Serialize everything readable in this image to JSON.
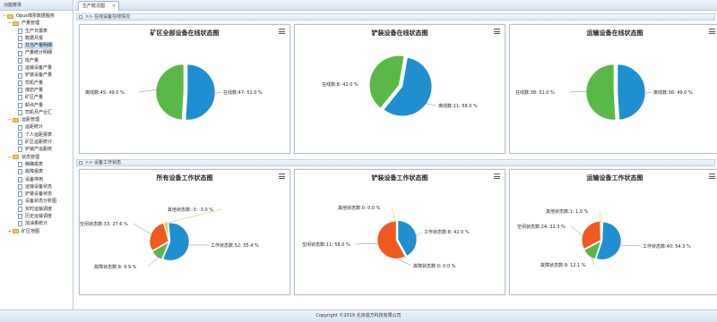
{
  "sidebar": {
    "title": "功能菜单",
    "items": [
      {
        "label": "Opus煤票数据服务",
        "level": 0,
        "type": "folder",
        "open": true
      },
      {
        "label": "产量管理",
        "level": 1,
        "type": "folder",
        "open": true
      },
      {
        "label": "生产日报表",
        "level": 2,
        "type": "doc"
      },
      {
        "label": "数据月报",
        "level": 2,
        "type": "doc"
      },
      {
        "label": "日当产量明细",
        "level": 2,
        "type": "doc",
        "selected": true
      },
      {
        "label": "产量统计明细",
        "level": 2,
        "type": "doc"
      },
      {
        "label": "班产量",
        "level": 2,
        "type": "doc"
      },
      {
        "label": "运输设备产量",
        "level": 2,
        "type": "doc"
      },
      {
        "label": "铲装设备产量",
        "level": 2,
        "type": "doc"
      },
      {
        "label": "司机产量",
        "level": 2,
        "type": "doc"
      },
      {
        "label": "煤岩产量",
        "level": 2,
        "type": "doc"
      },
      {
        "label": "矿区产量",
        "level": 2,
        "type": "doc"
      },
      {
        "label": "卸点产量",
        "level": 2,
        "type": "doc"
      },
      {
        "label": "司机月产台汇",
        "level": 2,
        "type": "doc"
      },
      {
        "label": "运距管理",
        "level": 1,
        "type": "folder",
        "open": true
      },
      {
        "label": "运距统计",
        "level": 2,
        "type": "doc"
      },
      {
        "label": "个人运距报表",
        "level": 2,
        "type": "doc"
      },
      {
        "label": "矿区运距统计",
        "level": 2,
        "type": "doc"
      },
      {
        "label": "铲装产运距统",
        "level": 2,
        "type": "doc"
      },
      {
        "label": "状态管理",
        "level": 1,
        "type": "folder",
        "open": true
      },
      {
        "label": "精确报表",
        "level": 2,
        "type": "doc"
      },
      {
        "label": "故障报表",
        "level": 2,
        "type": "doc"
      },
      {
        "label": "设备停用",
        "level": 2,
        "type": "doc"
      },
      {
        "label": "运输设备状态",
        "level": 2,
        "type": "doc"
      },
      {
        "label": "铲装设备状态",
        "level": 2,
        "type": "doc"
      },
      {
        "label": "设备状态分析图",
        "level": 2,
        "type": "doc"
      },
      {
        "label": "实时运输调度",
        "level": 2,
        "type": "doc"
      },
      {
        "label": "历史运输调度",
        "level": 2,
        "type": "doc"
      },
      {
        "label": "加油量统计",
        "level": 2,
        "type": "doc"
      },
      {
        "label": "矿区地图",
        "level": 1,
        "type": "folder",
        "open": false
      }
    ]
  },
  "tabs": [
    {
      "label": "生产概况图"
    }
  ],
  "sections": [
    {
      "title": ">> 在线设备在线情况"
    },
    {
      "title": ">> 设备工作状态"
    }
  ],
  "footer": "Copyright ©2019 北京逾方科技有限公司",
  "colors": {
    "green": "#59b947",
    "blue": "#1f8fd0",
    "orange": "#f05a1e",
    "yellow": "#f3cf3d"
  },
  "chart_data": [
    {
      "type": "pie",
      "title": "矿区全部设备在线状态图",
      "slices": [
        {
          "label": "在线数:47: 51.0 %",
          "value": 51.0,
          "color": "#1f8fd0"
        },
        {
          "label": "离线数:45: 49.0 %",
          "value": 49.0,
          "color": "#59b947"
        }
      ]
    },
    {
      "type": "pie",
      "title": "铲装设备在线状态图",
      "slices": [
        {
          "label": "离线数:11: 58.0 %",
          "value": 58.0,
          "color": "#1f8fd0"
        },
        {
          "label": "在线数:8: 42.0 %",
          "value": 42.0,
          "color": "#59b947"
        }
      ]
    },
    {
      "type": "pie",
      "title": "运输设备在线状态图",
      "slices": [
        {
          "label": "离线数:36: 49.0 %",
          "value": 49.0,
          "color": "#1f8fd0"
        },
        {
          "label": "在线数:38: 51.0 %",
          "value": 51.0,
          "color": "#59b947"
        }
      ]
    },
    {
      "type": "pie",
      "title": "所有设备工作状态图",
      "slices": [
        {
          "label": "工作状态数:52: 55.4 %",
          "value": 55.4,
          "color": "#1f8fd0"
        },
        {
          "label": "故障状态数:9: 9.9 %",
          "value": 9.9,
          "color": "#59b947"
        },
        {
          "label": "空闲状态数:33: 27.6 %",
          "value": 27.6,
          "color": "#f05a1e"
        },
        {
          "label": "其他状态数:-3: -3.0 %",
          "value": 3.0,
          "color": "#f3cf3d"
        }
      ]
    },
    {
      "type": "pie",
      "title": "铲装设备工作状态图",
      "slices": [
        {
          "label": "工作状态数:8: 42.0 %",
          "value": 42.0,
          "color": "#1f8fd0"
        },
        {
          "label": "故障状态数:0: 0.0 %",
          "value": 0.0,
          "color": "#59b947"
        },
        {
          "label": "空闲状态数:11: 58.0 %",
          "value": 58.0,
          "color": "#f05a1e"
        },
        {
          "label": "其他状态数:0: 0.0 %",
          "value": 0.0,
          "color": "#f3cf3d"
        }
      ]
    },
    {
      "type": "pie",
      "title": "运输设备工作状态图",
      "slices": [
        {
          "label": "工作状态数:40: 54.3 %",
          "value": 54.3,
          "color": "#1f8fd0"
        },
        {
          "label": "故障状态数:9: 12.1 %",
          "value": 12.1,
          "color": "#59b947"
        },
        {
          "label": "空闲状态数:24: 32.3 %",
          "value": 32.3,
          "color": "#f05a1e"
        },
        {
          "label": "其他状态数:1: 1.0 %",
          "value": 1.0,
          "color": "#f3cf3d"
        }
      ]
    }
  ]
}
